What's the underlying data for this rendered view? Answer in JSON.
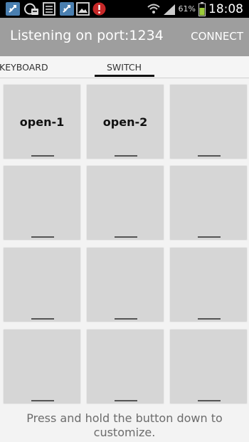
{
  "status_bar": {
    "icons": [
      "usb-icon",
      "sync-icon",
      "document-icon",
      "usb-icon",
      "image-icon",
      "alert-icon"
    ],
    "battery_percent": "61%",
    "time": "18:08"
  },
  "action_bar": {
    "title": "Listening on port:1234",
    "connect_label": "CONNECT"
  },
  "tabs": [
    {
      "label": "KEYBOARD",
      "selected": false
    },
    {
      "label": "SWITCH",
      "selected": true
    }
  ],
  "grid": {
    "rows": 4,
    "cols": 3,
    "cells": [
      "open-1",
      "open-2",
      "",
      "",
      "",
      "",
      "",
      "",
      "",
      "",
      "",
      ""
    ]
  },
  "footer": {
    "hint": "Press and hold the button down to customize."
  }
}
